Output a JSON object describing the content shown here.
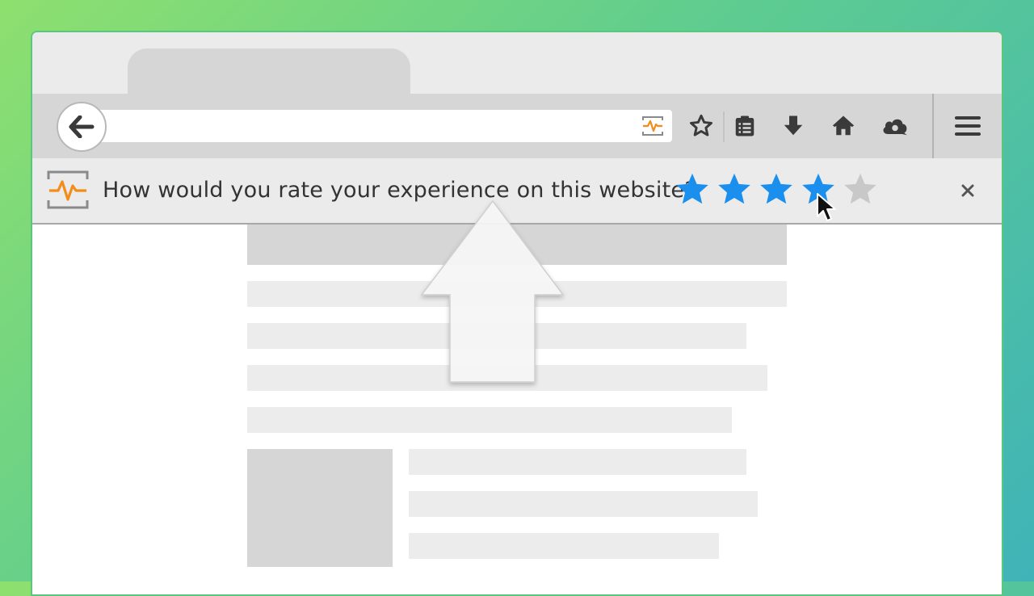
{
  "notification": {
    "question": "How would you rate your experience on this website?",
    "rating": {
      "filled": 4,
      "max": 5
    }
  },
  "colors": {
    "star_active": "#1a8fee",
    "star_inactive": "#c8c8c8",
    "heartbeat_accent": "#f28c1a",
    "background_start": "#8ee06e",
    "background_end": "#3fb3b8"
  },
  "icons": {
    "back": "arrow-left-icon",
    "page_action": "heartbeat-icon",
    "bookmark": "star-outline-icon",
    "reading_list": "clipboard-icon",
    "downloads": "download-arrow-icon",
    "home": "home-icon",
    "sync": "cloud-icon",
    "menu": "hamburger-icon",
    "close": "close-icon"
  }
}
